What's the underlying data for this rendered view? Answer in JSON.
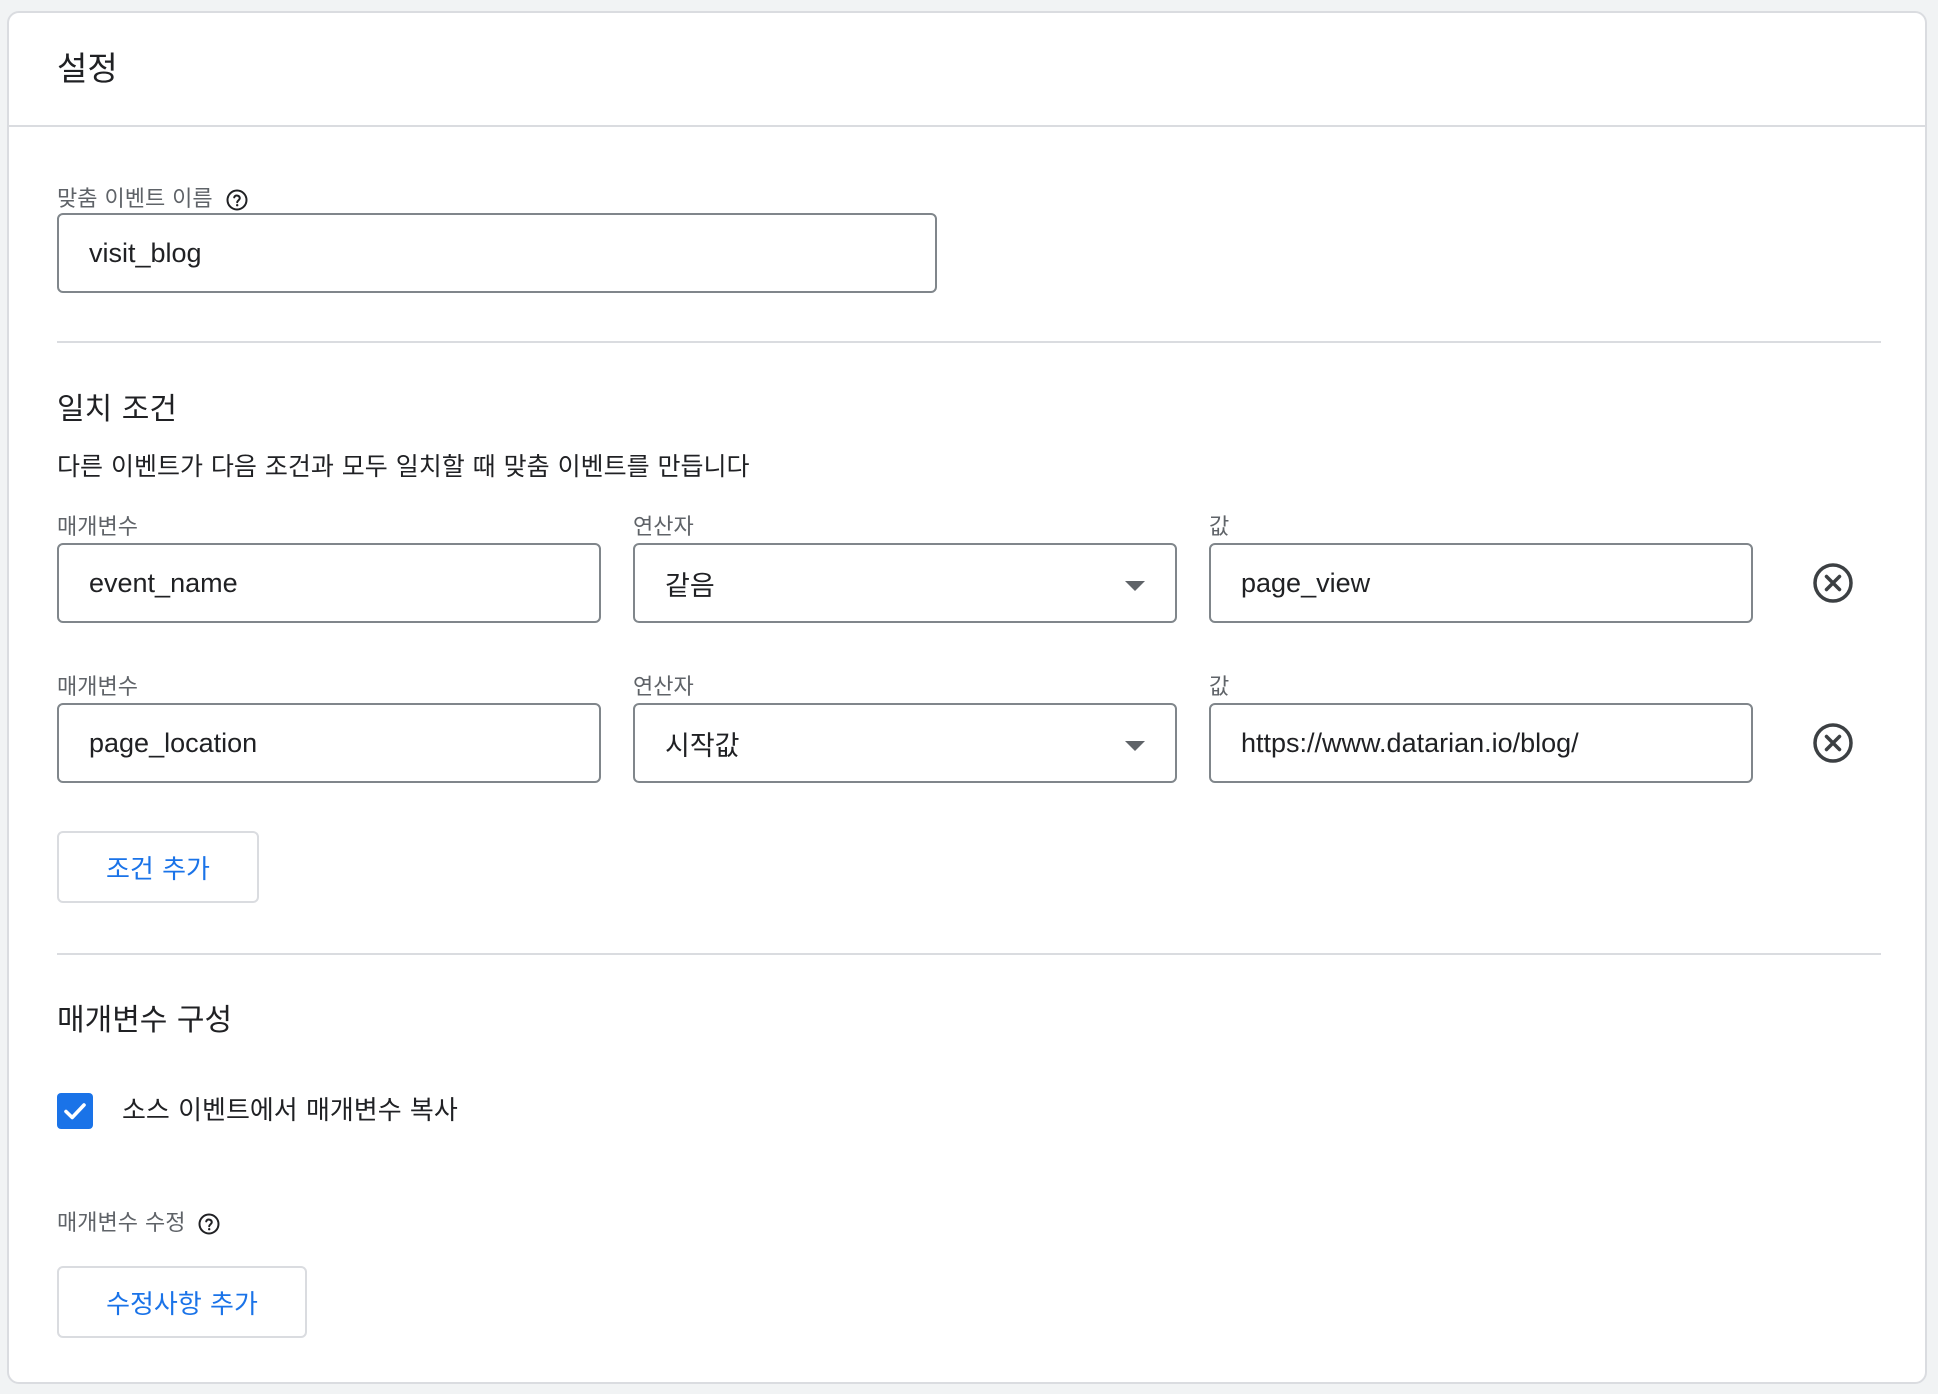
{
  "card": {
    "title": "설정"
  },
  "event_name": {
    "label": "맞춤 이벤트 이름",
    "value": "visit_blog"
  },
  "match_conditions": {
    "title": "일치 조건",
    "description": "다른 이벤트가 다음 조건과 모두 일치할 때 맞춤 이벤트를 만듭니다",
    "rows": [
      {
        "parameter_label": "매개변수",
        "parameter_value": "event_name",
        "operator_label": "연산자",
        "operator_value": "같음",
        "value_label": "값",
        "value_value": "page_view"
      },
      {
        "parameter_label": "매개변수",
        "parameter_value": "page_location",
        "operator_label": "연산자",
        "operator_value": "시작값",
        "value_label": "값",
        "value_value": "https://www.datarian.io/blog/"
      }
    ],
    "add_condition_label": "조건 추가"
  },
  "parameter_config": {
    "title": "매개변수 구성",
    "copy_checkbox_label": "소스 이벤트에서 매개변수 복사",
    "copy_checked": true,
    "modify_label": "매개변수 수정",
    "add_modification_label": "수정사항 추가"
  },
  "colors": {
    "accent": "#1a73e8",
    "border": "#dadce0",
    "field_border": "#80868b"
  },
  "icons": {
    "help": "help-circle-icon",
    "remove": "close-circle-icon",
    "caret": "dropdown-caret-icon",
    "check": "check-icon"
  }
}
